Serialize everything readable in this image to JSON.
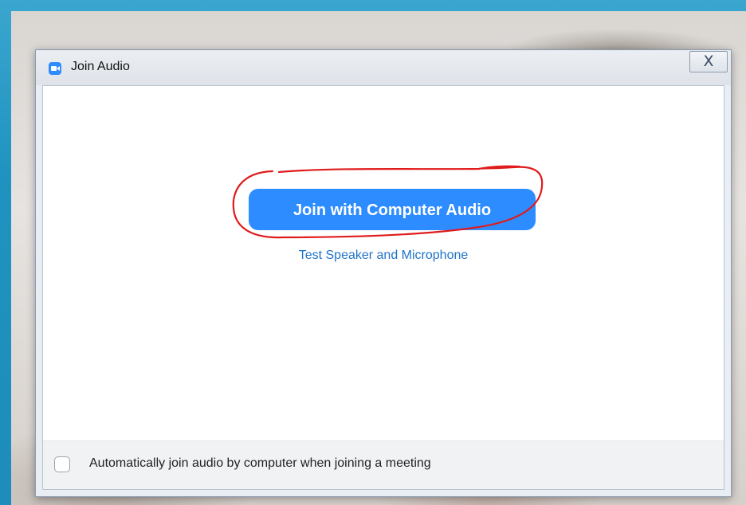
{
  "window": {
    "title": "Join Audio",
    "close_glyph": "X",
    "app_icon": "video-camera-icon"
  },
  "main": {
    "join_button_label": "Join with Computer Audio",
    "test_link_label": "Test Speaker and Microphone"
  },
  "footer": {
    "auto_join_label": "Automatically join audio by computer when joining a meeting",
    "auto_join_checked": false
  },
  "colors": {
    "accent": "#2d8cff",
    "link": "#1f73c8",
    "annotation": "#e01b1b",
    "desktop": "#1d8dbb"
  }
}
